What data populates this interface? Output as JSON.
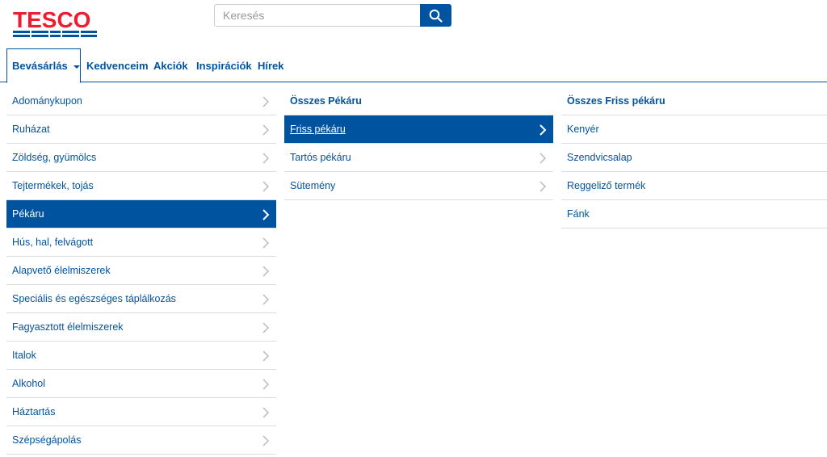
{
  "header": {
    "logo_text": "TESCO",
    "search_placeholder": "Keresés"
  },
  "nav": {
    "items": [
      {
        "label": "Bevásárlás",
        "active": true
      },
      {
        "label": "Kedvenceim"
      },
      {
        "label": "Akciók"
      },
      {
        "label": "Inspirációk"
      },
      {
        "label": "Hírek"
      }
    ]
  },
  "categories": [
    {
      "label": "Adománykupon"
    },
    {
      "label": "Ruházat"
    },
    {
      "label": "Zöldség, gyümölcs"
    },
    {
      "label": "Tejtermékek, tojás"
    },
    {
      "label": "Pékáru",
      "selected": true
    },
    {
      "label": "Hús, hal, felvágott"
    },
    {
      "label": "Alapvető élelmiszerek"
    },
    {
      "label": "Speciális és egészséges táplálkozás"
    },
    {
      "label": "Fagyasztott élelmiszerek"
    },
    {
      "label": "Italok"
    },
    {
      "label": "Alkohol"
    },
    {
      "label": "Háztartás"
    },
    {
      "label": "Szépségápolás"
    }
  ],
  "subcategories": {
    "all_label": "Összes Pékáru",
    "items": [
      {
        "label": "Friss pékáru",
        "selected": true
      },
      {
        "label": "Tartós pékáru"
      },
      {
        "label": "Sütemény"
      }
    ]
  },
  "subsubcategories": {
    "all_label": "Összes Friss pékáru",
    "items": [
      {
        "label": "Kenyér"
      },
      {
        "label": "Szendvicsalap"
      },
      {
        "label": "Reggeliző termék"
      },
      {
        "label": "Fánk"
      }
    ]
  },
  "colors": {
    "brand_blue": "#00539f",
    "brand_red": "#ee1c2e"
  }
}
